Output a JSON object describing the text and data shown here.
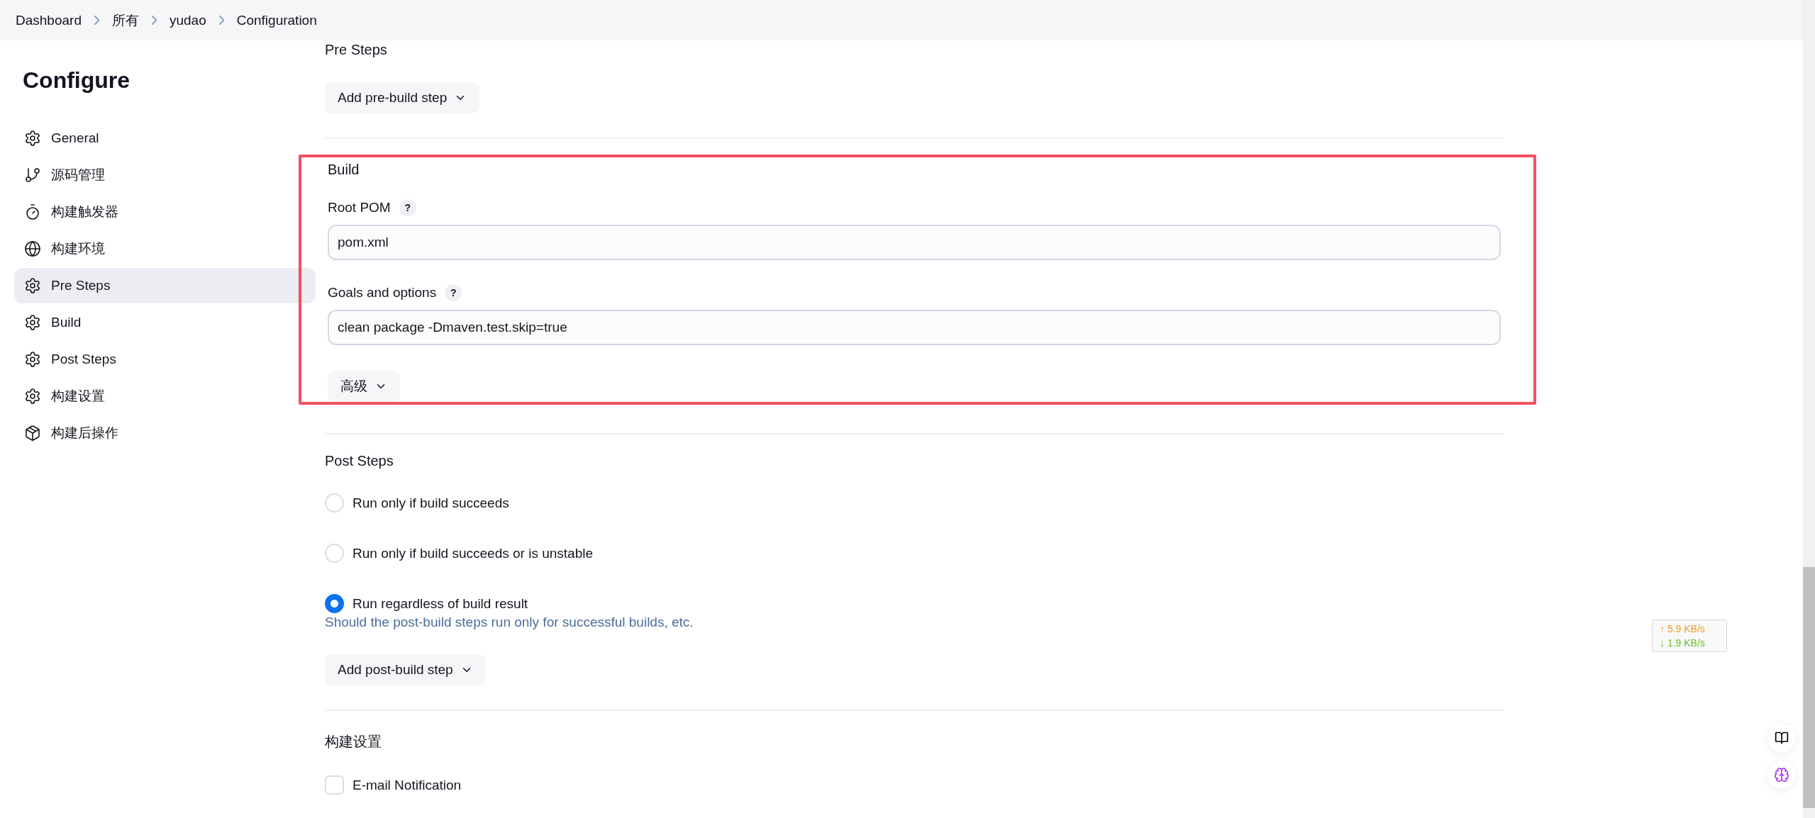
{
  "breadcrumb": [
    "Dashboard",
    "所有",
    "yudao",
    "Configuration"
  ],
  "sidebar": {
    "title": "Configure",
    "items": [
      {
        "label": "General",
        "selected": false
      },
      {
        "label": "源码管理",
        "selected": false
      },
      {
        "label": "构建触发器",
        "selected": false
      },
      {
        "label": "构建环境",
        "selected": false
      },
      {
        "label": "Pre Steps",
        "selected": true
      },
      {
        "label": "Build",
        "selected": false
      },
      {
        "label": "Post Steps",
        "selected": false
      },
      {
        "label": "构建设置",
        "selected": false
      },
      {
        "label": "构建后操作",
        "selected": false
      }
    ]
  },
  "pre_steps": {
    "title": "Pre Steps",
    "button": "Add pre-build step"
  },
  "build": {
    "title": "Build",
    "highlighted": true,
    "fields": [
      {
        "label": "Root POM",
        "help": "?",
        "value": "pom.xml"
      },
      {
        "label": "Goals and options",
        "help": "?",
        "value": "clean package -Dmaven.test.skip=true"
      }
    ],
    "advanced_button": "高级"
  },
  "post_steps": {
    "title": "Post Steps",
    "options": [
      {
        "label": "Run only if build succeeds",
        "selected": false
      },
      {
        "label": "Run only if build succeeds or is unstable",
        "selected": false
      },
      {
        "label": "Run regardless of build result",
        "selected": true
      }
    ],
    "description": "Should the post-build steps run only for successful builds, etc.",
    "button": "Add post-build step"
  },
  "build_settings": {
    "title": "构建设置",
    "checkboxes": [
      {
        "label": "E-mail Notification",
        "checked": false
      }
    ]
  },
  "network_speed": {
    "upload": "↑ 5.9 KB/s",
    "download": "↓ 1.9 KB/s"
  }
}
